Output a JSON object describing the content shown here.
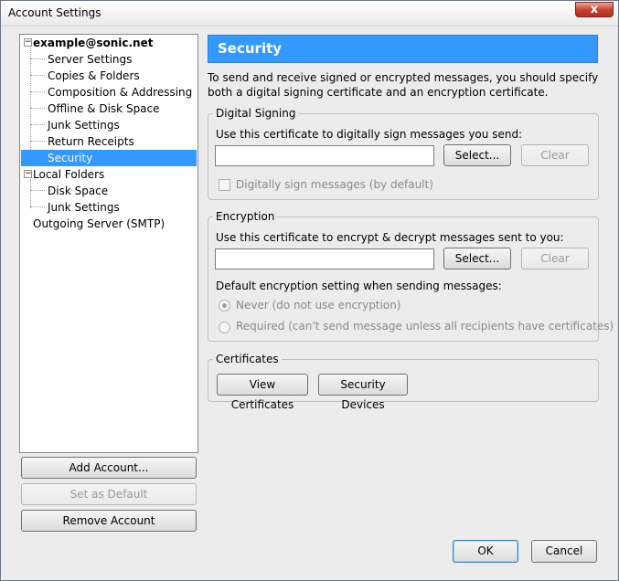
{
  "window": {
    "title": "Account Settings",
    "close_glyph": "x"
  },
  "tree": {
    "items": [
      {
        "label": "example@sonic.net",
        "level": 0,
        "expander": "−",
        "bold": true
      },
      {
        "label": "Server Settings",
        "level": 1
      },
      {
        "label": "Copies & Folders",
        "level": 1
      },
      {
        "label": "Composition & Addressing",
        "level": 1
      },
      {
        "label": "Offline & Disk Space",
        "level": 1
      },
      {
        "label": "Junk Settings",
        "level": 1
      },
      {
        "label": "Return Receipts",
        "level": 1
      },
      {
        "label": "Security",
        "level": 1,
        "selected": true
      },
      {
        "label": "Local Folders",
        "level": 0,
        "expander": "−"
      },
      {
        "label": "Disk Space",
        "level": 1
      },
      {
        "label": "Junk Settings",
        "level": 1
      },
      {
        "label": "Outgoing Server (SMTP)",
        "level": 0
      }
    ]
  },
  "left_buttons": {
    "add_account": "Add Account...",
    "set_default": "Set as Default",
    "remove_account": "Remove Account"
  },
  "panel": {
    "title": "Security",
    "intro": "To send and receive signed or encrypted messages, you should specify both a digital signing certificate and an encryption certificate.",
    "digital_signing": {
      "group_label": "Digital Signing",
      "prompt": "Use this certificate to digitally sign messages you send:",
      "value": "",
      "select_label": "Select...",
      "clear_label": "Clear",
      "checkbox_label": "Digitally sign messages (by default)"
    },
    "encryption": {
      "group_label": "Encryption",
      "prompt": "Use this certificate to encrypt & decrypt messages sent to you:",
      "value": "",
      "select_label": "Select...",
      "clear_label": "Clear",
      "default_setting_label": "Default encryption setting when sending messages:",
      "radio_never": "Never (do not use encryption)",
      "radio_required": "Required (can't send message unless all recipients have certificates)"
    },
    "certificates": {
      "group_label": "Certificates",
      "view_label": "View Certificates",
      "devices_label": "Security Devices"
    }
  },
  "footer": {
    "ok_label": "OK",
    "cancel_label": "Cancel"
  },
  "colors": {
    "selection": "#3399ff",
    "window_bg": "#ececec",
    "close_button": "#c5452f"
  }
}
